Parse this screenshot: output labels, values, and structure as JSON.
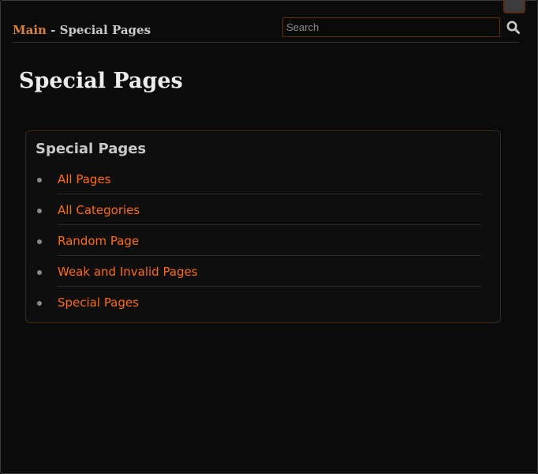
{
  "header": {
    "breadcrumb": {
      "home_label": "Main",
      "separator": " - ",
      "current_label": "Special Pages"
    },
    "search": {
      "placeholder": "Search",
      "value": ""
    },
    "search_icon": "magnifier-icon"
  },
  "page": {
    "title": "Special Pages"
  },
  "card": {
    "title": "Special Pages",
    "links": [
      {
        "label": "All Pages"
      },
      {
        "label": "All Categories"
      },
      {
        "label": "Random Page"
      },
      {
        "label": "Weak and Invalid Pages"
      },
      {
        "label": "Special Pages"
      }
    ]
  },
  "colors": {
    "background": "#0b0b0b",
    "link": "#ff6a0e",
    "breadcrumb_link": "#d9813c",
    "text": "#c8c8c8",
    "accent_border": "#5c3412"
  }
}
